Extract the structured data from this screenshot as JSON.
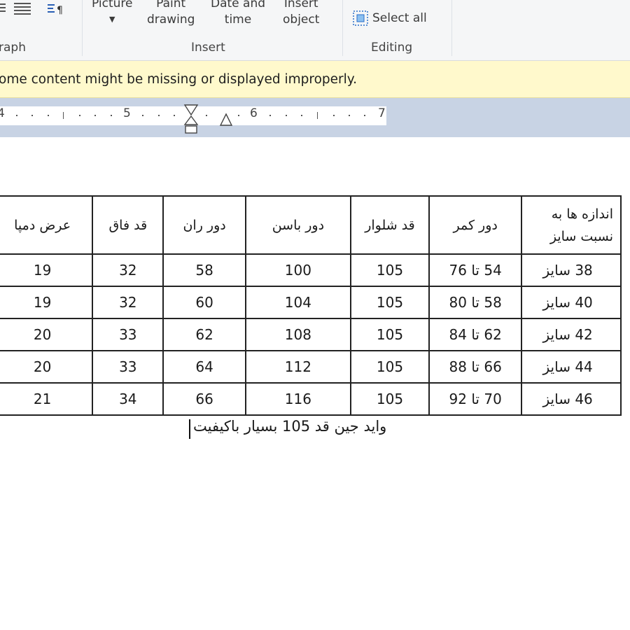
{
  "ribbon": {
    "paragraph_group_label": "raph",
    "insert_group_label": "Insert",
    "editing_group_label": "Editing",
    "picture_label": "Picture",
    "paint_drawing_line1": "Paint",
    "paint_drawing_line2": "drawing",
    "date_time_line1": "Date and",
    "date_time_line2": "time",
    "insert_object_line1": "Insert",
    "insert_object_line2": "object",
    "select_all_label": "Select all"
  },
  "infobar": {
    "message": "ome content might be missing or displayed improperly."
  },
  "ruler": {
    "numbers": [
      "4",
      "5",
      "6",
      "7"
    ]
  },
  "table": {
    "headers": [
      "عرض دمپا",
      "قد فاق",
      "دور ران",
      "دور باسن",
      "قد شلوار",
      "دور کمر",
      "اندازه ها به نسبت سایز"
    ],
    "rows": [
      [
        "19",
        "32",
        "58",
        "100",
        "105",
        "54 تا 76",
        "38 سایز"
      ],
      [
        "19",
        "32",
        "60",
        "104",
        "105",
        "58 تا 80",
        "40 سایز"
      ],
      [
        "20",
        "33",
        "62",
        "108",
        "105",
        "62 تا 84",
        "42 سایز"
      ],
      [
        "20",
        "33",
        "64",
        "112",
        "105",
        "66 تا 88",
        "44 سایز"
      ],
      [
        "21",
        "34",
        "66",
        "116",
        "105",
        "70 تا 92",
        "46 سایز"
      ]
    ]
  },
  "caption": "واید جین قد 105  بسیار باکیفیت"
}
